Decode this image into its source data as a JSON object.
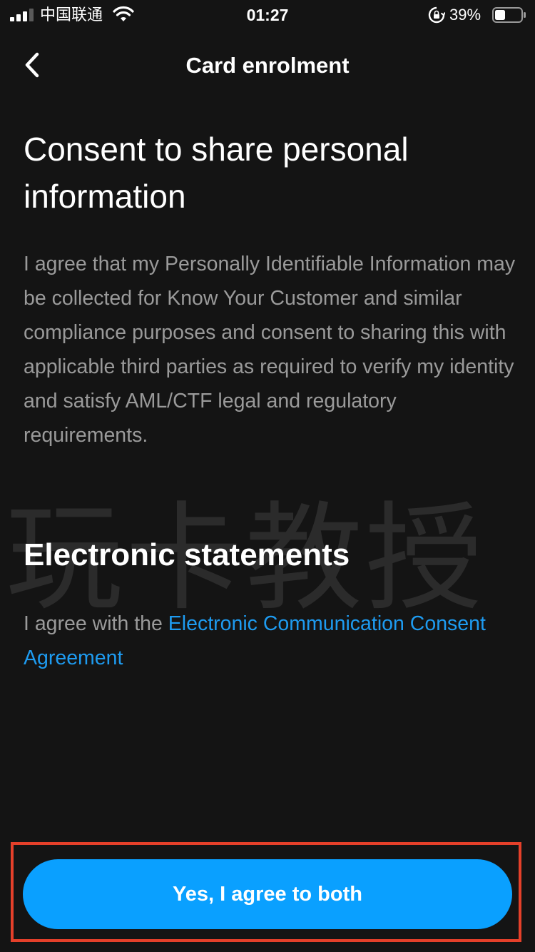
{
  "status_bar": {
    "carrier": "中国联通",
    "time": "01:27",
    "battery_percent": "39%",
    "battery_level": 0.39,
    "icons": [
      "signal-icon",
      "wifi-icon",
      "rotation-lock-icon",
      "battery-icon"
    ]
  },
  "nav": {
    "title": "Card enrolment",
    "back_icon": "chevron-left-icon"
  },
  "consent": {
    "title": "Consent to share personal information",
    "body": "I agree that my Personally Identifiable Information may be collected for Know Your Customer and similar compliance purposes and consent to sharing this with applicable third parties as required to verify my identity and satisfy AML/CTF legal and regulatory requirements."
  },
  "statements": {
    "title": "Electronic statements",
    "prefix": "I agree with the ",
    "link_text": "Electronic Communication Consent Agreement"
  },
  "watermark": "玩卡教授",
  "action": {
    "button_label": "Yes, I agree to both"
  },
  "colors": {
    "background": "#141414",
    "primary": "#0aa0ff",
    "link": "#1e9bf0",
    "body_text": "#9a9a9a",
    "highlight": "#e5402a"
  }
}
